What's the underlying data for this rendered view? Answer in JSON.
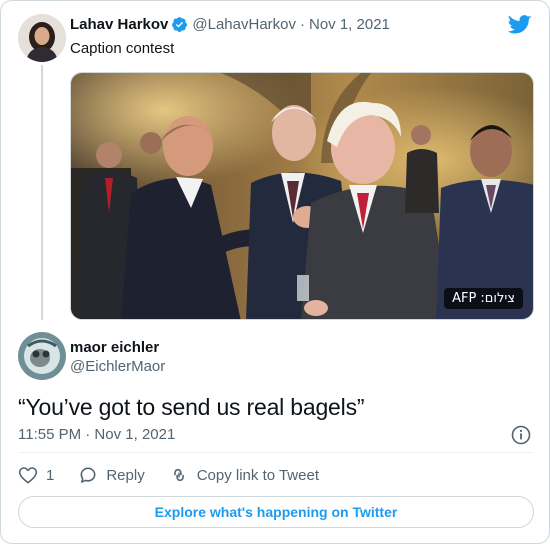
{
  "parent_tweet": {
    "author_name": "Lahav Harkov",
    "author_handle": "@LahavHarkov",
    "separator": "·",
    "date": "Nov 1, 2021",
    "text": "Caption contest",
    "photo_credit": "צילום: AFP"
  },
  "reply_tweet": {
    "author_name": "maor eichler",
    "author_handle": "@EichlerMaor",
    "text": "“You’ve got to send us real bagels”",
    "timestamp": "11:55 PM · Nov 1, 2021"
  },
  "actions": {
    "like_count": "1",
    "reply_label": "Reply",
    "copy_label": "Copy link to Tweet"
  },
  "explore_label": "Explore what's happening on Twitter",
  "icons": {
    "brand": "twitter-bird-icon",
    "verified": "verified-badge-icon",
    "info": "info-icon",
    "like": "heart-icon",
    "reply": "speech-bubble-icon",
    "copy": "link-icon"
  },
  "colors": {
    "accent": "#1d9bf0",
    "text": "#0f1419",
    "secondary": "#536471",
    "border": "#cfd9de"
  }
}
